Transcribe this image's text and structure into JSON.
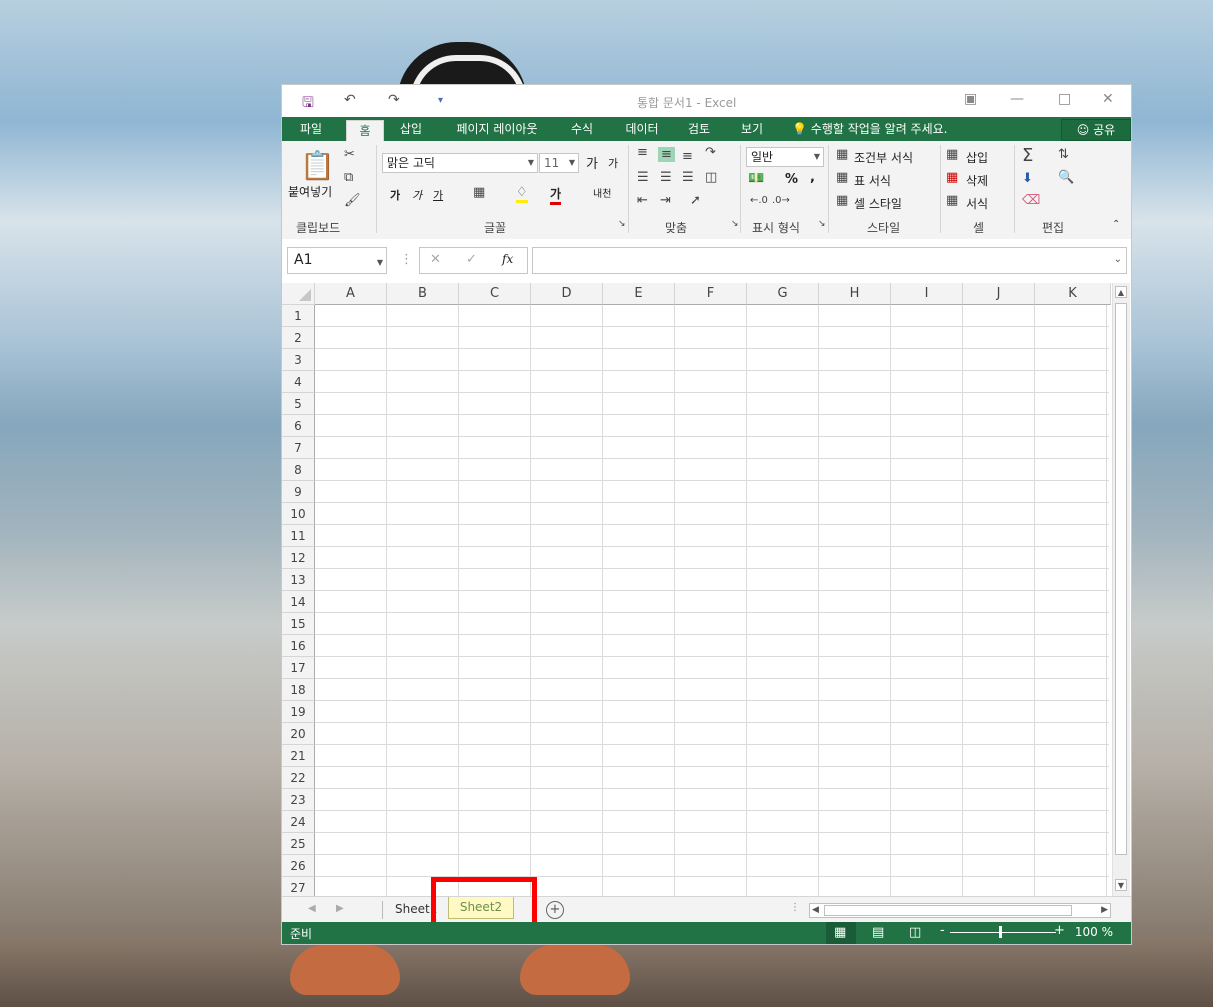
{
  "window": {
    "title": "통합 문서1 - Excel"
  },
  "tabs": [
    "파일",
    "홈",
    "삽입",
    "페이지 레이아웃",
    "수식",
    "데이터",
    "검토",
    "보기"
  ],
  "tell_me": "수행할 작업을 알려 주세요.",
  "share_label": "공유",
  "ribbon": {
    "clipboard": {
      "paste_label": "붙여넣기",
      "group": "클립보드"
    },
    "font": {
      "name": "맑은 고딕",
      "size": "11",
      "bold": "가",
      "italic": "가",
      "underline": "가",
      "color_a": "가",
      "grow": "가",
      "shrink": "가",
      "phonetic": "내천",
      "group": "글꼴"
    },
    "alignment": {
      "group": "맞춤"
    },
    "number": {
      "format": "일반",
      "percent": "%",
      "comma": ",",
      "group": "표시 형식"
    },
    "styles": {
      "conditional": "조건부 서식",
      "table": "표 서식",
      "cell_style": "셀 스타일",
      "group": "스타일"
    },
    "cells": {
      "insert": "삽입",
      "delete": "삭제",
      "format": "서식",
      "group": "셀"
    },
    "editing": {
      "group": "편집"
    }
  },
  "formula_bar": {
    "name_box": "A1",
    "fx": "fx",
    "formula": ""
  },
  "columns": [
    "A",
    "B",
    "C",
    "D",
    "E",
    "F",
    "G",
    "H",
    "I",
    "J",
    "K"
  ],
  "rows": [
    "1",
    "2",
    "3",
    "4",
    "5",
    "6",
    "7",
    "8",
    "9",
    "10",
    "11",
    "12",
    "13",
    "14",
    "15",
    "16",
    "17",
    "18",
    "19",
    "20",
    "21",
    "22",
    "23",
    "24",
    "25",
    "26",
    "27"
  ],
  "sheets": [
    "Sheet1",
    "Sheet2"
  ],
  "status": {
    "ready": "준비",
    "zoom": "100 %"
  },
  "colors": {
    "accent": "#217346",
    "highlight_border": "#ff0000",
    "sheet2_fill": "#fff9c4"
  }
}
